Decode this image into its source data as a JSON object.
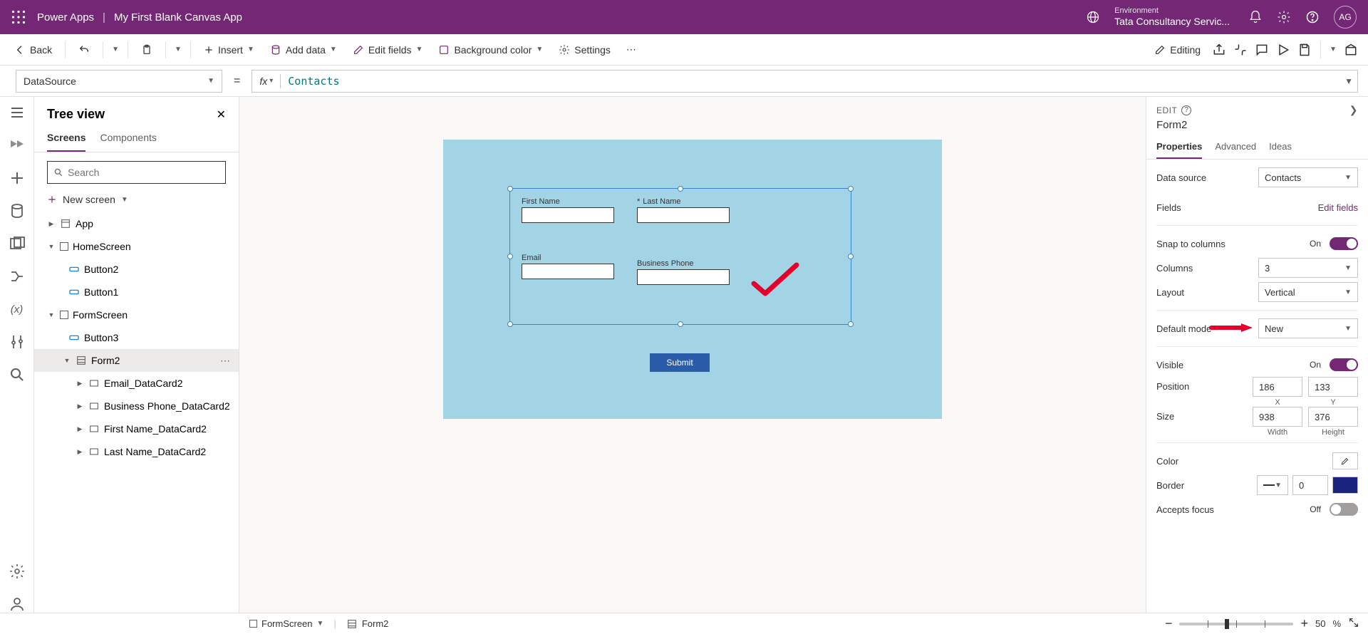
{
  "header": {
    "product": "Power Apps",
    "appName": "My First Blank Canvas App",
    "environmentLabel": "Environment",
    "environmentValue": "Tata Consultancy Servic...",
    "avatarInitials": "AG"
  },
  "cmd": {
    "back": "Back",
    "insert": "Insert",
    "addData": "Add data",
    "editFields": "Edit fields",
    "bgColor": "Background color",
    "settings": "Settings",
    "editing": "Editing"
  },
  "formula": {
    "property": "DataSource",
    "fx": "fx",
    "value": "Contacts"
  },
  "tree": {
    "title": "Tree view",
    "tabScreens": "Screens",
    "tabComponents": "Components",
    "searchPlaceholder": "Search",
    "newScreen": "New screen",
    "items": {
      "app": "App",
      "home": "HomeScreen",
      "btn2": "Button2",
      "btn1": "Button1",
      "formScreen": "FormScreen",
      "btn3": "Button3",
      "form2": "Form2",
      "dcEmail": "Email_DataCard2",
      "dcPhone": "Business Phone_DataCard2",
      "dcFirst": "First Name_DataCard2",
      "dcLast": "Last Name_DataCard2"
    }
  },
  "canvas": {
    "fields": {
      "firstName": "First Name",
      "lastName": "Last Name",
      "lastNameReq": "*",
      "email": "Email",
      "phone": "Business Phone"
    },
    "submit": "Submit"
  },
  "props": {
    "editLabel": "EDIT",
    "objName": "Form2",
    "tabs": {
      "properties": "Properties",
      "advanced": "Advanced",
      "ideas": "Ideas"
    },
    "dataSource": {
      "label": "Data source",
      "value": "Contacts"
    },
    "fieldsLabel": "Fields",
    "editFieldsLink": "Edit fields",
    "snapLabel": "Snap to columns",
    "snapState": "On",
    "columns": {
      "label": "Columns",
      "value": "3"
    },
    "layout": {
      "label": "Layout",
      "value": "Vertical"
    },
    "defaultMode": {
      "label": "Default mode",
      "value": "New"
    },
    "visible": {
      "label": "Visible",
      "state": "On"
    },
    "position": {
      "label": "Position",
      "x": "186",
      "y": "133",
      "xl": "X",
      "yl": "Y"
    },
    "size": {
      "label": "Size",
      "w": "938",
      "h": "376",
      "wl": "Width",
      "hl": "Height"
    },
    "colorLabel": "Color",
    "border": {
      "label": "Border",
      "value": "0"
    },
    "acceptsFocus": {
      "label": "Accepts focus",
      "state": "Off"
    }
  },
  "status": {
    "crumb1": "FormScreen",
    "crumb2": "Form2",
    "zoomPct": "50",
    "pct": "%"
  }
}
